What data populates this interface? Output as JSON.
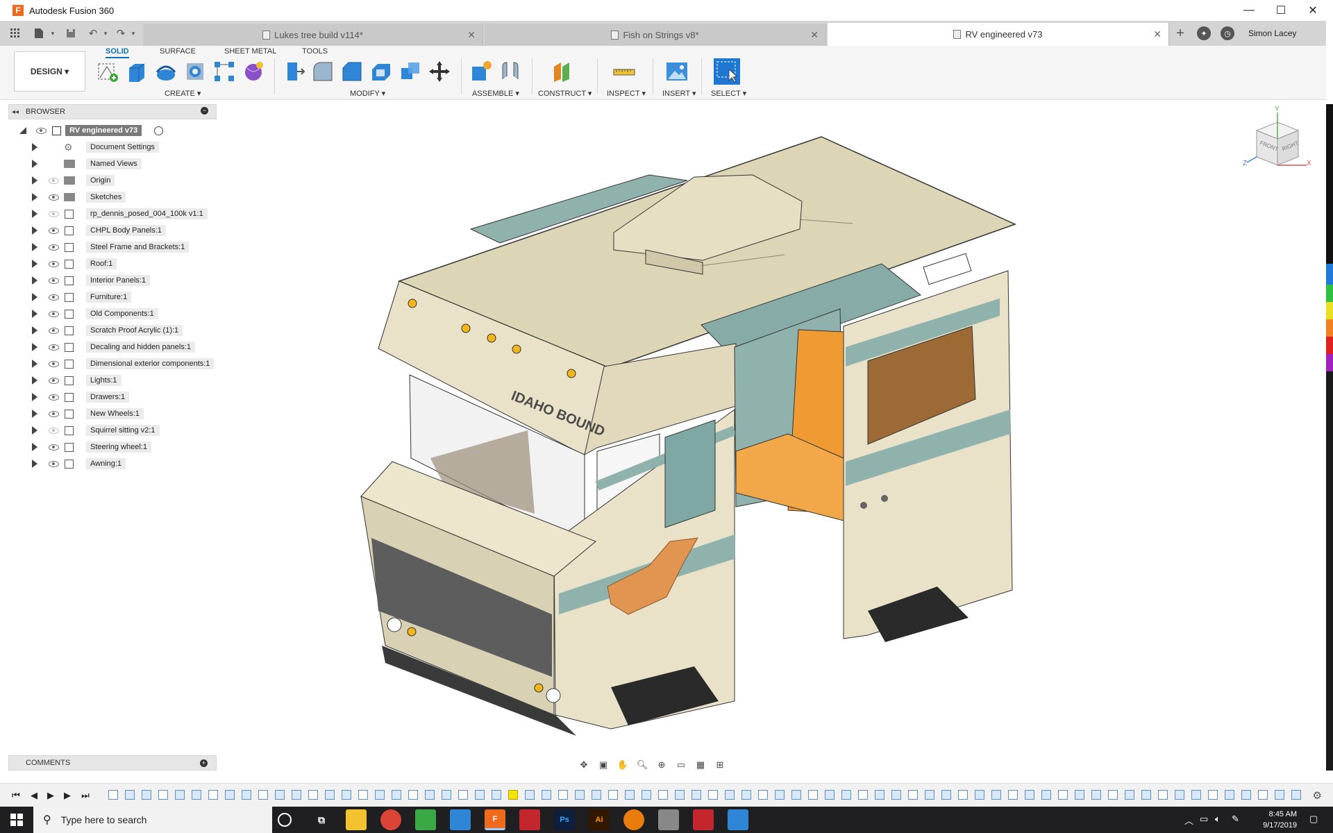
{
  "window": {
    "title": "Autodesk Fusion 360",
    "app_logo": "F",
    "controls": [
      "—",
      "☐",
      "✕"
    ]
  },
  "tabs": [
    {
      "label": "Lukes tree build v114*",
      "active": false
    },
    {
      "label": "Fish on Strings v8*",
      "active": false
    },
    {
      "label": "RV engineered v73",
      "active": true
    }
  ],
  "user": {
    "name": "Simon Lacey"
  },
  "workspace": {
    "label": "DESIGN ▾"
  },
  "ribbon": {
    "tabs": [
      "SOLID",
      "SURFACE",
      "SHEET METAL",
      "TOOLS"
    ],
    "groups": [
      "CREATE ▾",
      "MODIFY ▾",
      "ASSEMBLE ▾",
      "CONSTRUCT ▾",
      "INSPECT ▾",
      "INSERT ▾",
      "SELECT ▾"
    ]
  },
  "browser": {
    "title": "BROWSER",
    "root": "RV engineered v73",
    "items": [
      {
        "label": "Document Settings",
        "icon": "gear-icon",
        "eye": false
      },
      {
        "label": "Named Views",
        "icon": "folder-icon",
        "eye": false
      },
      {
        "label": "Origin",
        "icon": "folder-icon",
        "eye": true,
        "eye_hidden": true
      },
      {
        "label": "Sketches",
        "icon": "folder-icon",
        "eye": true
      },
      {
        "label": "rp_dennis_posed_004_100k v1:1",
        "icon": "component-icon",
        "eye": true,
        "eye_hidden": true
      },
      {
        "label": "CHPL Body Panels:1",
        "icon": "component-icon",
        "eye": true
      },
      {
        "label": "Steel Frame and Brackets:1",
        "icon": "component-icon",
        "eye": true
      },
      {
        "label": "Roof:1",
        "icon": "component-icon",
        "eye": true
      },
      {
        "label": "Interior Panels:1",
        "icon": "component-icon",
        "eye": true
      },
      {
        "label": "Furniture:1",
        "icon": "component-icon",
        "eye": true
      },
      {
        "label": "Old Components:1",
        "icon": "component-icon",
        "eye": true
      },
      {
        "label": "Scratch Proof Acrylic (1):1",
        "icon": "component-icon",
        "eye": true
      },
      {
        "label": "Decaling and hidden panels:1",
        "icon": "component-icon",
        "eye": true
      },
      {
        "label": "Dimensional exterior components:1",
        "icon": "component-icon",
        "eye": true
      },
      {
        "label": "Lights:1",
        "icon": "component-icon",
        "eye": true
      },
      {
        "label": "Drawers:1",
        "icon": "component-icon",
        "eye": true
      },
      {
        "label": "New Wheels:1",
        "icon": "component-icon",
        "eye": true
      },
      {
        "label": "Squirrel sitting v2:1",
        "icon": "component-icon",
        "eye": true,
        "eye_hidden": true
      },
      {
        "label": "Steering wheel:1",
        "icon": "component-icon",
        "eye": true
      },
      {
        "label": "Awning:1",
        "icon": "component-icon",
        "eye": true
      }
    ]
  },
  "comments": {
    "title": "COMMENTS"
  },
  "model": {
    "decal_text": "IDAHO BOUND"
  },
  "viewcube": {
    "front": "FRONT",
    "right": "RIGHT",
    "y": "Y",
    "x": "X",
    "z": "Z"
  },
  "taskbar": {
    "search_placeholder": "Type here to search",
    "time": "8:45 AM",
    "date": "9/17/2019"
  },
  "colors": {
    "accent": "#0a6fc2",
    "rv_body": "#e8dfc3",
    "rv_teal": "#7fa8a4",
    "rv_orange": "#ef9a32"
  }
}
